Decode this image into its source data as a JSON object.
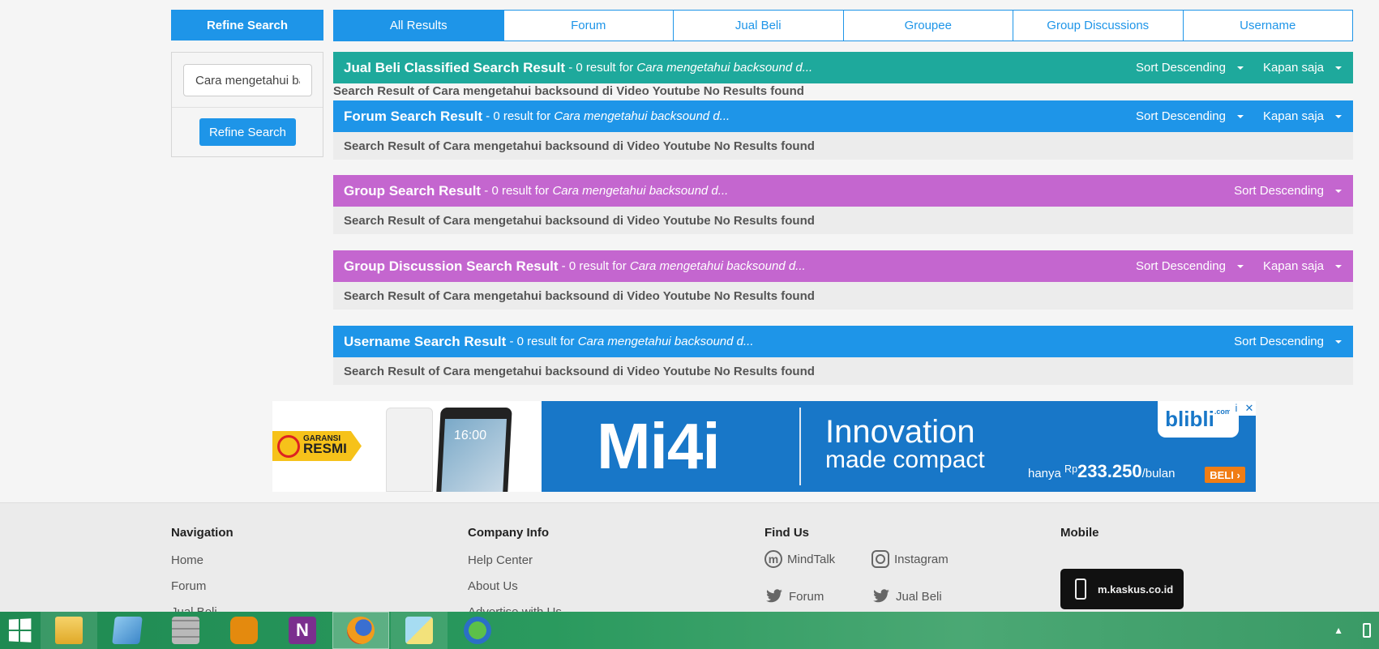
{
  "sidebar": {
    "heading": "Refine Search",
    "input_value": "Cara mengetahui backsound di Video Youtube",
    "button_label": "Refine Search"
  },
  "tabs": [
    {
      "label": "All Results",
      "active": true
    },
    {
      "label": "Forum",
      "active": false
    },
    {
      "label": "Jual Beli",
      "active": false
    },
    {
      "label": "Groupee",
      "active": false
    },
    {
      "label": "Group Discussions",
      "active": false
    },
    {
      "label": "Username",
      "active": false
    }
  ],
  "sections": {
    "jual_beli": {
      "title": "Jual Beli Classified Search Result",
      "count_text": " - 0 result for ",
      "query": "Cara mengetahui backsound d...",
      "sort": "Sort Descending",
      "time": "Kapan saja",
      "message": "Search Result of Cara mengetahui backsound di Video Youtube No Results found",
      "color": "#1ea99c"
    },
    "forum": {
      "title": "Forum Search Result",
      "count_text": " - 0 result for ",
      "query": "Cara mengetahui backsound d...",
      "sort": "Sort Descending",
      "time": "Kapan saja",
      "message": "Search Result of Cara mengetahui backsound di Video Youtube No Results found",
      "color": "#1e95e8"
    },
    "group": {
      "title": "Group Search Result",
      "count_text": " - 0 result for ",
      "query": "Cara mengetahui backsound d...",
      "sort": "Sort Descending",
      "message": "Search Result of Cara mengetahui backsound di Video Youtube No Results found",
      "color": "#c466cf"
    },
    "group_discussion": {
      "title": "Group Discussion Search Result",
      "count_text": " - 0 result for ",
      "query": "Cara mengetahui backsound d...",
      "sort": "Sort Descending",
      "time": "Kapan saja",
      "message": "Search Result of Cara mengetahui backsound di Video Youtube No Results found",
      "color": "#c466cf"
    },
    "username": {
      "title": "Username Search Result",
      "count_text": " - 0 result for ",
      "query": "Cara mengetahui backsound d...",
      "sort": "Sort Descending",
      "message": "Search Result of Cara mengetahui backsound di Video Youtube No Results found",
      "color": "#1e95e8"
    }
  },
  "ad": {
    "badge_top": "GARANSI",
    "badge_bottom": "RESMI",
    "phone_time": "16:00",
    "product": "Mi4i",
    "tagline_1": "Innovation",
    "tagline_2": "made compact",
    "brand": "blibli",
    "brand_suffix": ".com",
    "price_prefix": "hanya",
    "price_currency": "Rp",
    "price": "233.250",
    "price_suffix": "/bulan",
    "cta": "BELI",
    "info_icon": "i",
    "close_icon": "✕"
  },
  "footer": {
    "navigation": {
      "heading": "Navigation",
      "links": [
        "Home",
        "Forum",
        "Jual Beli"
      ]
    },
    "company": {
      "heading": "Company Info",
      "links": [
        "Help Center",
        "About Us",
        "Advertise with Us"
      ]
    },
    "find_us": {
      "heading": "Find Us",
      "items": [
        {
          "label": "MindTalk",
          "icon": "mindtalk-icon"
        },
        {
          "label": "Instagram",
          "icon": "instagram-icon"
        },
        {
          "label": "Forum",
          "icon": "twitter-icon"
        },
        {
          "label": "Jual Beli",
          "icon": "twitter-icon"
        }
      ]
    },
    "mobile": {
      "heading": "Mobile",
      "badge": "m.kaskus.co.id"
    }
  },
  "taskbar": {
    "apps": [
      "file-explorer",
      "notepad",
      "firewall",
      "archive",
      "onenote",
      "firefox",
      "sticky-notes",
      "internet-download-manager"
    ],
    "active_app": "firefox"
  }
}
